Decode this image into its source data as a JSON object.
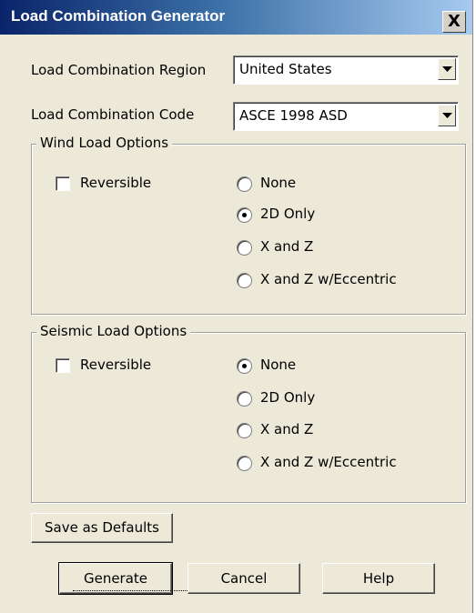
{
  "window": {
    "title": "Load Combination Generator",
    "close_label": "X"
  },
  "region": {
    "label": "Load Combination Region",
    "value": "United States"
  },
  "code": {
    "label": "Load Combination Code",
    "value": "ASCE 1998 ASD"
  },
  "wind": {
    "legend": "Wind Load Options",
    "reversible_label": "Reversible",
    "reversible_checked": false,
    "options": [
      "None",
      "2D Only",
      "X and Z",
      "X and Z w/Eccentric"
    ],
    "selected": "2D Only"
  },
  "seismic": {
    "legend": "Seismic Load Options",
    "reversible_label": "Reversible",
    "reversible_checked": false,
    "options": [
      "None",
      "2D Only",
      "X and Z",
      "X and Z w/Eccentric"
    ],
    "selected": "None"
  },
  "buttons": {
    "save_defaults": "Save as Defaults",
    "generate": "Generate",
    "cancel": "Cancel",
    "help": "Help"
  }
}
